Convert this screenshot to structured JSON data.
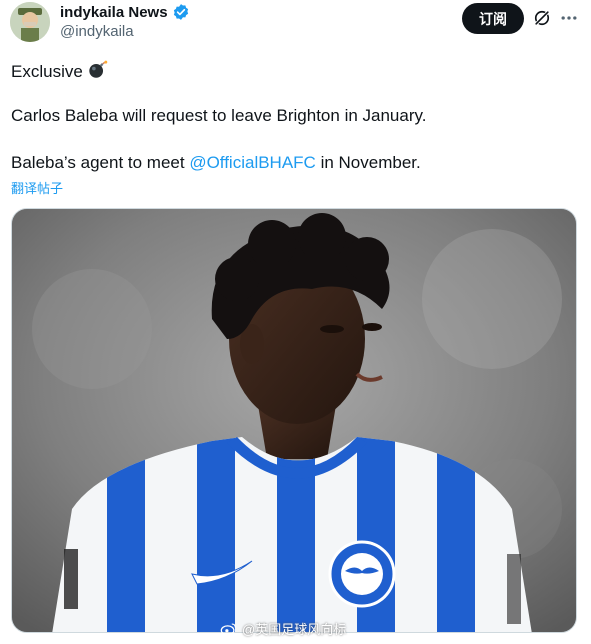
{
  "author": {
    "display_name": "indykaila News",
    "handle": "@indykaila",
    "verified": true,
    "verified_color": "#1d9bf0"
  },
  "actions": {
    "subscribe_label": "订阅"
  },
  "tweet": {
    "line1": "Exclusive",
    "line1_emoji": "bomb-icon",
    "line2": "Carlos Baleba will request to leave Brighton in January.",
    "line3_prefix": "Baleba’s agent to meet ",
    "line3_mention": "@OfficialBHAFC",
    "line3_suffix": " in November.",
    "translate_label": "翻译帖子"
  },
  "media": {
    "image": "football-player-photo",
    "watermark": "@英国足球风向标",
    "watermark_icon": "weibo-icon"
  },
  "colors": {
    "text": "#0f1419",
    "secondary": "#536471",
    "link": "#1d9bf0",
    "jersey_blue": "#1f5fcf"
  }
}
